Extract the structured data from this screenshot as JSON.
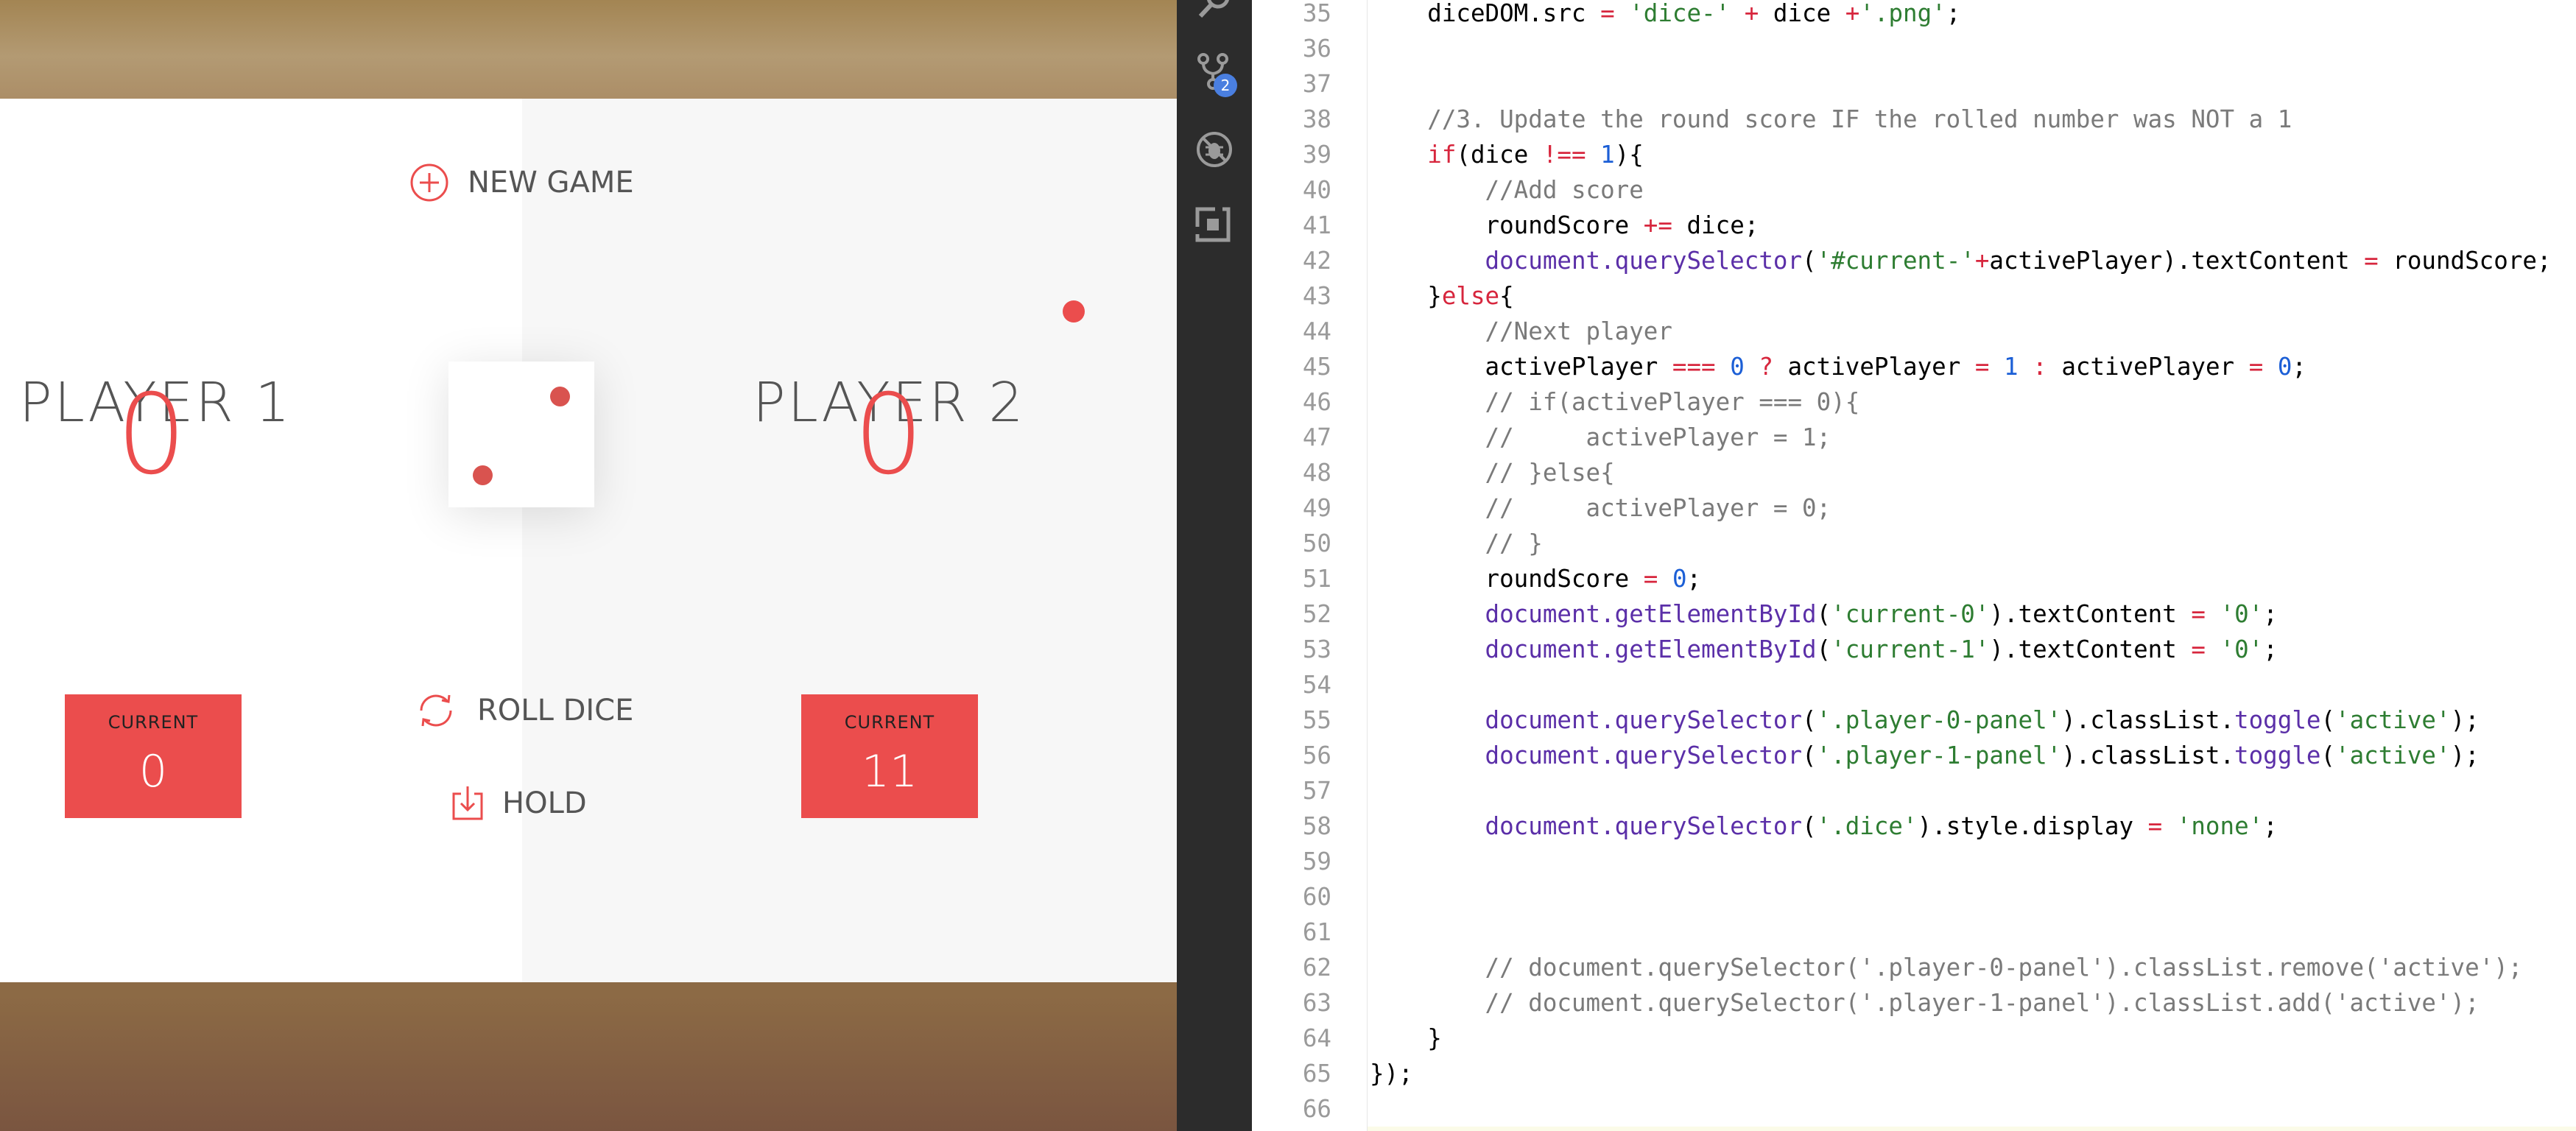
{
  "game": {
    "new_game": "NEW GAME",
    "roll_dice": "ROLL DICE",
    "hold": "HOLD",
    "players": [
      {
        "name": "PLAYER 1",
        "score": "0",
        "current_label": "CURRENT",
        "current_score": "0",
        "active": false
      },
      {
        "name": "PLAYER 2",
        "score": "0",
        "current_label": "CURRENT",
        "current_score": "11",
        "active": true
      }
    ],
    "dice_value": 2,
    "accent_color": "#eb4d4d"
  },
  "activity_bar": {
    "items": [
      "search-icon",
      "source-control-icon",
      "debug-icon",
      "extensions-icon"
    ],
    "source_control_badge": "2"
  },
  "editor": {
    "lines": [
      {
        "n": "35",
        "t": "    diceDOM.src = 'dice-' + dice +'.png';"
      },
      {
        "n": "36",
        "t": ""
      },
      {
        "n": "37",
        "t": ""
      },
      {
        "n": "38",
        "t": "    //3. Update the round score IF the rolled number was NOT a 1"
      },
      {
        "n": "39",
        "t": "    if(dice !== 1){"
      },
      {
        "n": "40",
        "t": "        //Add score"
      },
      {
        "n": "41",
        "t": "        roundScore += dice;"
      },
      {
        "n": "42",
        "t": "        document.querySelector('#current-'+activePlayer).textContent = roundScore;"
      },
      {
        "n": "43",
        "t": "    }else{"
      },
      {
        "n": "44",
        "t": "        //Next player"
      },
      {
        "n": "45",
        "t": "        activePlayer === 0 ? activePlayer = 1 : activePlayer = 0;"
      },
      {
        "n": "46",
        "t": "        // if(activePlayer === 0){"
      },
      {
        "n": "47",
        "t": "        //     activePlayer = 1;"
      },
      {
        "n": "48",
        "t": "        // }else{"
      },
      {
        "n": "49",
        "t": "        //     activePlayer = 0;"
      },
      {
        "n": "50",
        "t": "        // }"
      },
      {
        "n": "51",
        "t": "        roundScore = 0;"
      },
      {
        "n": "52",
        "t": "        document.getElementById('current-0').textContent = '0';"
      },
      {
        "n": "53",
        "t": "        document.getElementById('current-1').textContent = '0';"
      },
      {
        "n": "54",
        "t": ""
      },
      {
        "n": "55",
        "t": "        document.querySelector('.player-0-panel').classList.toggle('active');"
      },
      {
        "n": "56",
        "t": "        document.querySelector('.player-1-panel').classList.toggle('active');"
      },
      {
        "n": "57",
        "t": ""
      },
      {
        "n": "58",
        "t": "        document.querySelector('.dice').style.display = 'none';"
      },
      {
        "n": "59",
        "t": ""
      },
      {
        "n": "60",
        "t": ""
      },
      {
        "n": "61",
        "t": ""
      },
      {
        "n": "62",
        "t": "        // document.querySelector('.player-0-panel').classList.remove('active');"
      },
      {
        "n": "63",
        "t": "        // document.querySelector('.player-1-panel').classList.add('active');"
      },
      {
        "n": "64",
        "t": "    }"
      },
      {
        "n": "65",
        "t": "});"
      },
      {
        "n": "66",
        "t": ""
      }
    ]
  }
}
